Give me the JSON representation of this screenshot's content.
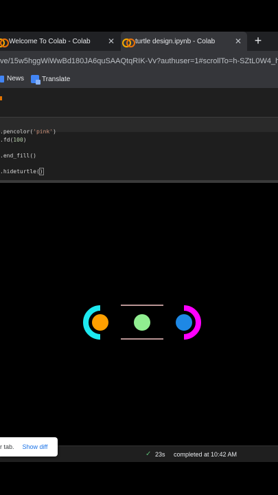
{
  "browser": {
    "tabs": [
      {
        "title": "Welcome To Colab - Colab",
        "close": "✕"
      },
      {
        "title": "turtle design.ipynb - Colab",
        "close": "✕"
      }
    ],
    "new_tab": "+",
    "url": "ve/15w5hggWiWwBd180JA6quSAAQtqRIK-Vv?authuser=1#scrollTo=h-SZtL0W4_hg",
    "bookmarks": [
      "News",
      "Translate"
    ]
  },
  "code": {
    "line1_prefix": ".pencolor(",
    "line1_arg": "'pink'",
    "line1_suffix": ")",
    "line2_prefix": ".fd(",
    "line2_arg": "100",
    "line2_suffix": ")",
    "line3": ".end_fill()",
    "line4_prefix": ".hideturtle(",
    "line4_paren": ")"
  },
  "output_drawing": {
    "colors": {
      "left_arc": "#1de9f0",
      "left_dot": "#ffa000",
      "center_dot": "#90ee90",
      "right_dot": "#1e88e5",
      "right_arc": "#ff00ff",
      "lines": "#f5c6c6"
    }
  },
  "status": {
    "check": "✓",
    "duration": "23s",
    "completed": "completed at 10:42 AM"
  },
  "toast": {
    "message": "r tab.",
    "action": "Show diff"
  }
}
